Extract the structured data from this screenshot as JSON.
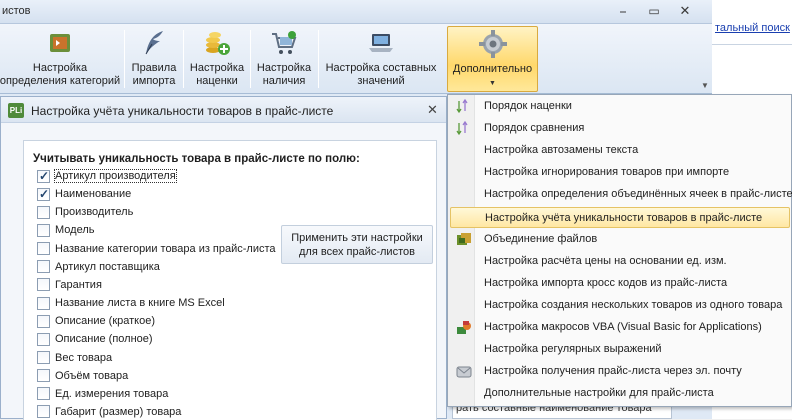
{
  "main_window": {
    "title": "истов",
    "controls": {
      "minimize": "⎯",
      "maximize": "▭",
      "close": "✕"
    }
  },
  "ribbon": {
    "buttons": [
      {
        "label": "Настройка определения категорий",
        "icon": "category-setup-icon"
      },
      {
        "label": "Правила импорта",
        "icon": "quill-pen-icon"
      },
      {
        "label": "Настройка наценки",
        "icon": "coins-add-icon"
      },
      {
        "label": "Настройка наличия",
        "icon": "shopping-cart-icon"
      },
      {
        "label": "Настройка составных значений",
        "icon": "laptop-icon"
      },
      {
        "label": "Дополнительно",
        "icon": "gear-icon"
      }
    ]
  },
  "dialog": {
    "logo_text": "PLi",
    "title": "Настройка учёта уникальности товаров в прайс-листе",
    "close_glyph": "✕",
    "heading": "Учитывать уникальность товара в прайс-листе по полю:",
    "apply_button": "Применить эти настройки для всех прайс-листов",
    "fields": [
      {
        "label": "Артикул производителя",
        "checked": true
      },
      {
        "label": "Наименование",
        "checked": true
      },
      {
        "label": "Производитель",
        "checked": false
      },
      {
        "label": "Модель",
        "checked": false
      },
      {
        "label": "Название категории товара из прайс-листа",
        "checked": false
      },
      {
        "label": "Артикул поставщика",
        "checked": false
      },
      {
        "label": "Гарантия",
        "checked": false
      },
      {
        "label": "Название листа в книге MS Excel",
        "checked": false
      },
      {
        "label": "Описание (краткое)",
        "checked": false
      },
      {
        "label": "Описание (полное)",
        "checked": false
      },
      {
        "label": "Вес товара",
        "checked": false
      },
      {
        "label": "Объём товара",
        "checked": false
      },
      {
        "label": "Ед. измерения товара",
        "checked": false
      },
      {
        "label": "Габарит (размер) товара",
        "checked": false
      }
    ]
  },
  "menu": {
    "items": [
      {
        "label": "Порядок наценки",
        "icon": "sort-arrows-icon",
        "highlighted": false
      },
      {
        "label": "Порядок сравнения",
        "icon": "sort-arrows-icon",
        "highlighted": false
      },
      {
        "label": "Настройка автозамены текста",
        "icon": "",
        "highlighted": false
      },
      {
        "label": "Настройка игнорирования товаров при импорте",
        "icon": "",
        "highlighted": false
      },
      {
        "label": "Настройка определения объединённых ячеек в прайс-листе",
        "icon": "",
        "highlighted": false
      },
      {
        "label": "Настройка учёта уникальности товаров в прайс-листе",
        "icon": "",
        "highlighted": true
      },
      {
        "label": "Объединение файлов",
        "icon": "merge-files-icon",
        "highlighted": false
      },
      {
        "label": "Настройка расчёта цены на основании ед. изм.",
        "icon": "",
        "highlighted": false
      },
      {
        "label": "Настройка импорта кросс кодов из прайс-листа",
        "icon": "",
        "highlighted": false
      },
      {
        "label": "Настройка создания нескольких товаров из одного товара",
        "icon": "",
        "highlighted": false
      },
      {
        "label": "Настройка макросов VBA (Visual Basic for Applications)",
        "icon": "vba-macro-icon",
        "highlighted": false
      },
      {
        "label": "Настройка регулярных выражений",
        "icon": "",
        "highlighted": false
      },
      {
        "label": "Настройка получения прайс-листа через эл. почту",
        "icon": "email-icon",
        "highlighted": false
      },
      {
        "label": "Дополнительные настройки для прайс-листа",
        "icon": "",
        "highlighted": false
      }
    ]
  },
  "right_window": {
    "link_text": "тальный поиск",
    "bottom_text": "рать составные наименование товара"
  },
  "colors": {
    "menu_highlight": "#ffe7a3",
    "ribbon_active": "#ffd86b",
    "link": "#1a3fb0"
  }
}
